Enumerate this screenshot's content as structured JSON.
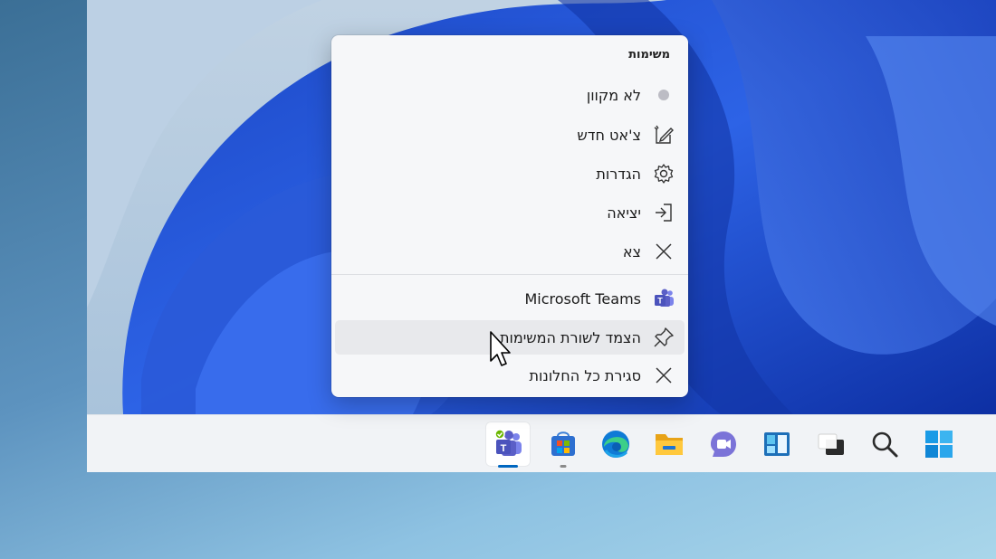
{
  "jump_list": {
    "header": "משימות",
    "tasks": [
      {
        "icon": "status-dot-icon",
        "label": "לא מקוון"
      },
      {
        "icon": "new-chat-icon",
        "label": "צ'אט חדש"
      },
      {
        "icon": "gear-icon",
        "label": "הגדרות"
      },
      {
        "icon": "sign-out-icon",
        "label": "יציאה"
      },
      {
        "icon": "close-icon",
        "label": "צא"
      }
    ],
    "app_actions": [
      {
        "icon": "teams-icon",
        "label": "Microsoft Teams"
      },
      {
        "icon": "pin-icon",
        "label": "הצמד לשורת המשימות"
      },
      {
        "icon": "close-icon",
        "label": "סגירת כל החלונות"
      }
    ]
  },
  "taskbar": {
    "apps": [
      {
        "icon": "teams-icon",
        "active": true
      },
      {
        "icon": "store-icon",
        "active": false
      },
      {
        "icon": "edge-icon",
        "active": false
      },
      {
        "icon": "file-explorer-icon",
        "active": false
      },
      {
        "icon": "teams-chat-icon",
        "active": false
      },
      {
        "icon": "widgets-icon",
        "active": false
      },
      {
        "icon": "task-view-icon",
        "active": false
      },
      {
        "icon": "search-icon",
        "active": false
      },
      {
        "icon": "start-icon",
        "active": false
      }
    ]
  },
  "colors": {
    "wallpaper_blue": "#1f4fd0",
    "accent": "#0067c0",
    "teams_purple": "#5b5fc7"
  }
}
